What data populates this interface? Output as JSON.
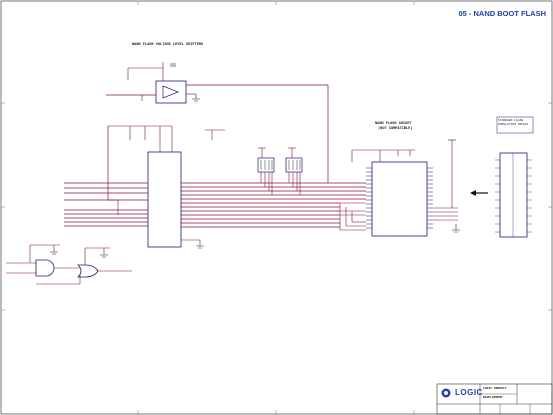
{
  "sheet": {
    "title": "05 - NAND BOOT FLASH"
  },
  "labels": {
    "level_shifter": "NAND FLASH VOLTAGE LEVEL SHIFTERS",
    "nand_socket": "NAND FLASH SOCKET",
    "nand_socket_sub": "(NOT COMPATIBLE)",
    "population_note": "STANDARD FLASH POPULATION SOCKET"
  },
  "title_block": {
    "logo": "LOGIC",
    "line1": "LOGIC PRODUCT",
    "line2": "DEVELOPMENT"
  },
  "colors": {
    "wire": "#8b0f3a",
    "component": "#1a1a8c",
    "title": "#1f3fbf",
    "frame": "#333333"
  }
}
